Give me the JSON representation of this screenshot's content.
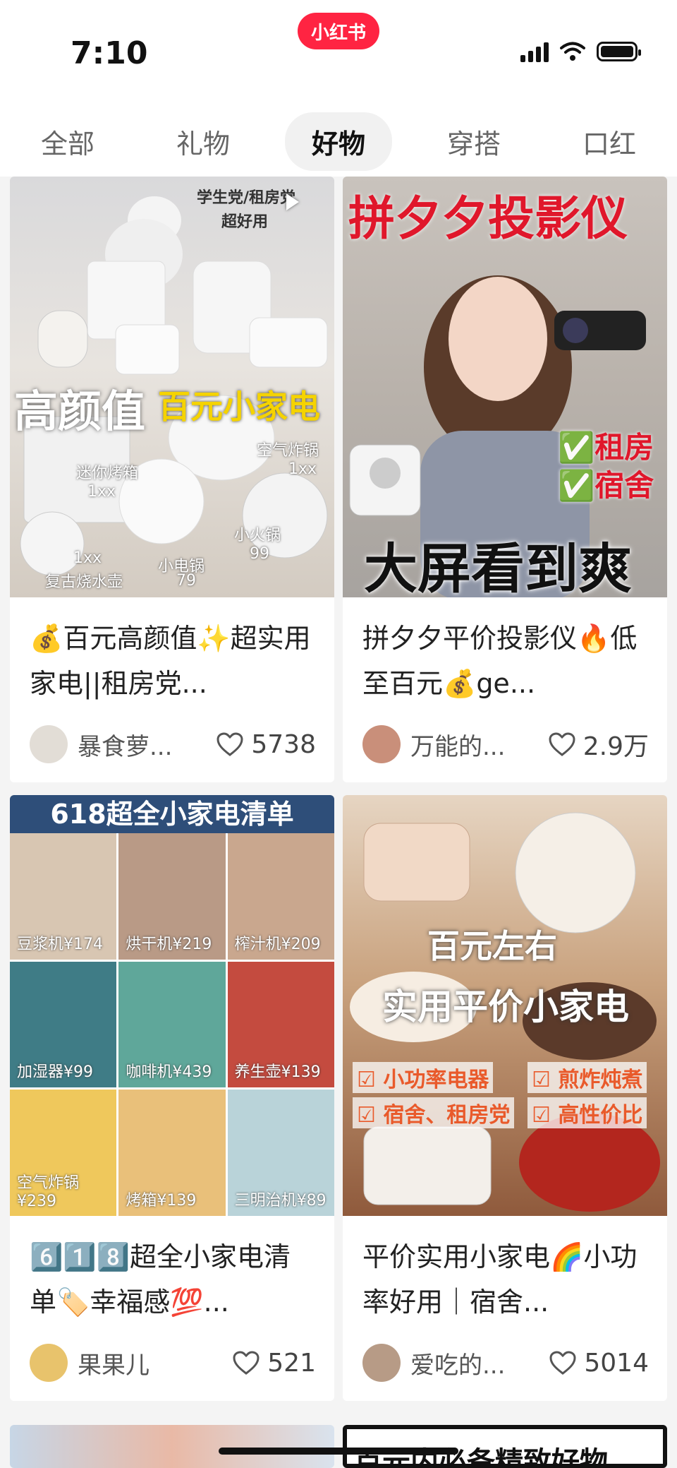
{
  "status": {
    "time": "7:10",
    "brand": "小红书"
  },
  "tabs": [
    {
      "label": "全部",
      "active": false
    },
    {
      "label": "礼物",
      "active": false
    },
    {
      "label": "好物",
      "active": true
    },
    {
      "label": "穿搭",
      "active": false
    },
    {
      "label": "口红",
      "active": false
    }
  ],
  "cards": [
    {
      "cover_headline": "高颜值",
      "cover_headline_yellow": "百元小家电",
      "cover_checks": [
        "学生党/租房党",
        "超好用"
      ],
      "cover_labels": [
        "迷你烤箱",
        "1xx",
        "空气炸锅",
        "1xx",
        "小火锅",
        "99",
        "小电锅",
        "79",
        "1xx",
        "复古烧水壶"
      ],
      "title": "💰百元高颜值✨超实用家电||租房党...",
      "author": "暴食萝...",
      "likes": "5738"
    },
    {
      "cover_top": "拼夕夕投影仪",
      "cover_checks": [
        "✅租房",
        "✅宿舍"
      ],
      "cover_bottom": "大屏看到爽",
      "title": "拼夕夕平价投影仪🔥低至百元💰ge...",
      "author": "万能的...",
      "likes": "2.9万"
    },
    {
      "cover_header": "618超全小家电清单",
      "cover_labels": [
        "豆浆机¥174",
        "烘干机¥219",
        "榨汁机¥209",
        "加湿器¥99",
        "咖啡机¥439",
        "养生壶¥139",
        "空气炸锅¥239",
        "烤箱¥139",
        "三明治机¥89"
      ],
      "title": "6️⃣1️⃣8️⃣超全小家电清单🏷️幸福感💯...",
      "author": "果果儿",
      "likes": "521"
    },
    {
      "cover_top": "百元左右",
      "cover_mid": "实用平价小家电",
      "cover_checks": [
        "☑ 小功率电器",
        "☑ 煎炸炖煮",
        "☑ 宿舍、租房党",
        "☑ 高性价比"
      ],
      "title": "平价实用小家电🌈小功率好用｜宿舍...",
      "author": "爱吃的...",
      "likes": "5014"
    }
  ],
  "partial_row": {
    "right_text": "百元内必备精致好物"
  }
}
